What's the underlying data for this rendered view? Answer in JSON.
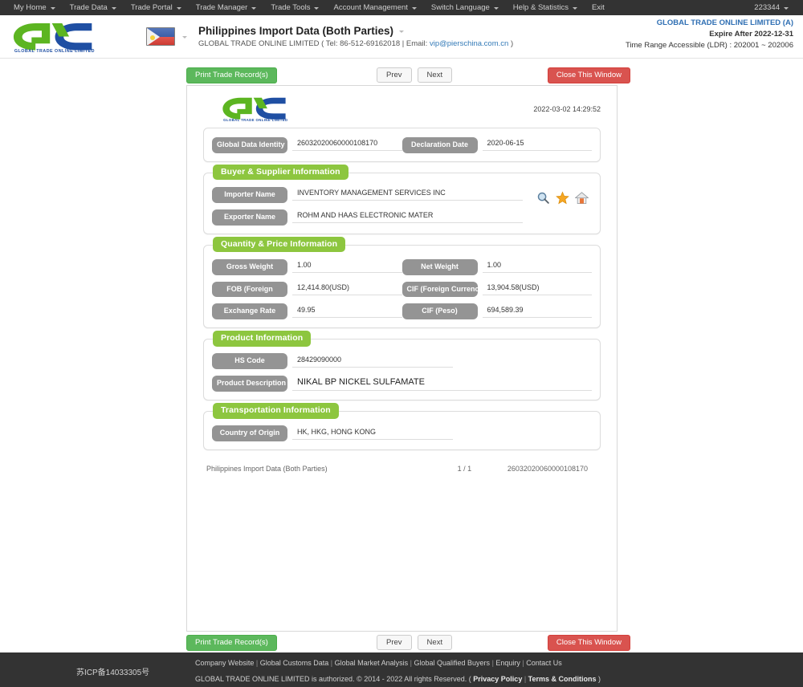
{
  "topnav": {
    "items": [
      {
        "label": "My Home",
        "caret": true
      },
      {
        "label": "Trade Data",
        "caret": true
      },
      {
        "label": "Trade Portal",
        "caret": true
      },
      {
        "label": "Trade Manager",
        "caret": true
      },
      {
        "label": "Trade Tools",
        "caret": true
      },
      {
        "label": "Account Management",
        "caret": true
      },
      {
        "label": "Switch Language",
        "caret": true
      },
      {
        "label": "Help & Statistics",
        "caret": true
      },
      {
        "label": "Exit",
        "caret": false
      }
    ],
    "user": "223344"
  },
  "header": {
    "logo_text": "GLOBAL TRADE ONLINE LIMITED",
    "flag": "philippines-flag",
    "title": "Philippines Import Data (Both Parties)",
    "subtitle_prefix": "GLOBAL TRADE ONLINE LIMITED ( Tel: 86-512-69162018  |  Email: ",
    "subtitle_email": "vip@pierschina.com.cn",
    "subtitle_suffix": " )",
    "account_name": "GLOBAL TRADE ONLINE LIMITED (A)",
    "expire": "Expire After 2022-12-31",
    "time_range": "Time Range Accessible (LDR) : 202001 ~ 202006"
  },
  "actions": {
    "print": "Print Trade Record(s)",
    "prev": "Prev",
    "next": "Next",
    "close": "Close This Window"
  },
  "document": {
    "timestamp": "2022-03-02 14:29:52",
    "identity": {
      "label_id": "Global Data Identity",
      "value_id": "26032020060000108170",
      "label_date": "Declaration Date",
      "value_date": "2020-06-15"
    },
    "buyer_supplier": {
      "heading": "Buyer & Supplier Information",
      "importer_label": "Importer Name",
      "importer_value": "INVENTORY MANAGEMENT SERVICES INC",
      "exporter_label": "Exporter Name",
      "exporter_value": "ROHM AND HAAS ELECTRONIC MATER",
      "icons": [
        "search-icon",
        "star-icon",
        "home-icon"
      ]
    },
    "quantity_price": {
      "heading": "Quantity & Price Information",
      "gross_weight_label": "Gross Weight",
      "gross_weight_value": "1.00",
      "net_weight_label": "Net Weight",
      "net_weight_value": "1.00",
      "fob_label": "FOB (Foreign",
      "fob_value": "12,414.80(USD)",
      "cif_fc_label": "CIF (Foreign Currency)",
      "cif_fc_value": "13,904.58(USD)",
      "exchange_rate_label": "Exchange Rate",
      "exchange_rate_value": "49.95",
      "cif_peso_label": "CIF  (Peso)",
      "cif_peso_value": "694,589.39"
    },
    "product": {
      "heading": "Product Information",
      "hs_label": "HS Code",
      "hs_value": "28429090000",
      "desc_label": "Product Description",
      "desc_value": "NIKAL BP NICKEL SULFAMATE"
    },
    "transportation": {
      "heading": "Transportation Information",
      "origin_label": "Country of Origin",
      "origin_value": "HK, HKG, HONG KONG"
    },
    "footer": {
      "source": "Philippines Import Data (Both Parties)",
      "page": "1 / 1",
      "ref": "26032020060000108170"
    }
  },
  "footer": {
    "icp": "苏ICP备14033305号",
    "links": [
      "Company Website",
      "Global Customs Data",
      "Global Market Analysis",
      "Global Qualified Buyers",
      "Enquiry",
      "Contact Us"
    ],
    "copy_text": "GLOBAL TRADE ONLINE LIMITED is authorized. © 2014 - 2022 All rights Reserved.  ( ",
    "privacy": "Privacy Policy",
    "terms": "Terms & Conditions",
    "copy_suffix": " )"
  },
  "colors": {
    "brand_green": "#8dc63f",
    "brand_blue": "#1f4fa3",
    "nav_dark": "#333333",
    "btn_green": "#5cb85c",
    "btn_red": "#d9534f",
    "pill_gray": "#949494",
    "link_blue": "#337ab7"
  }
}
